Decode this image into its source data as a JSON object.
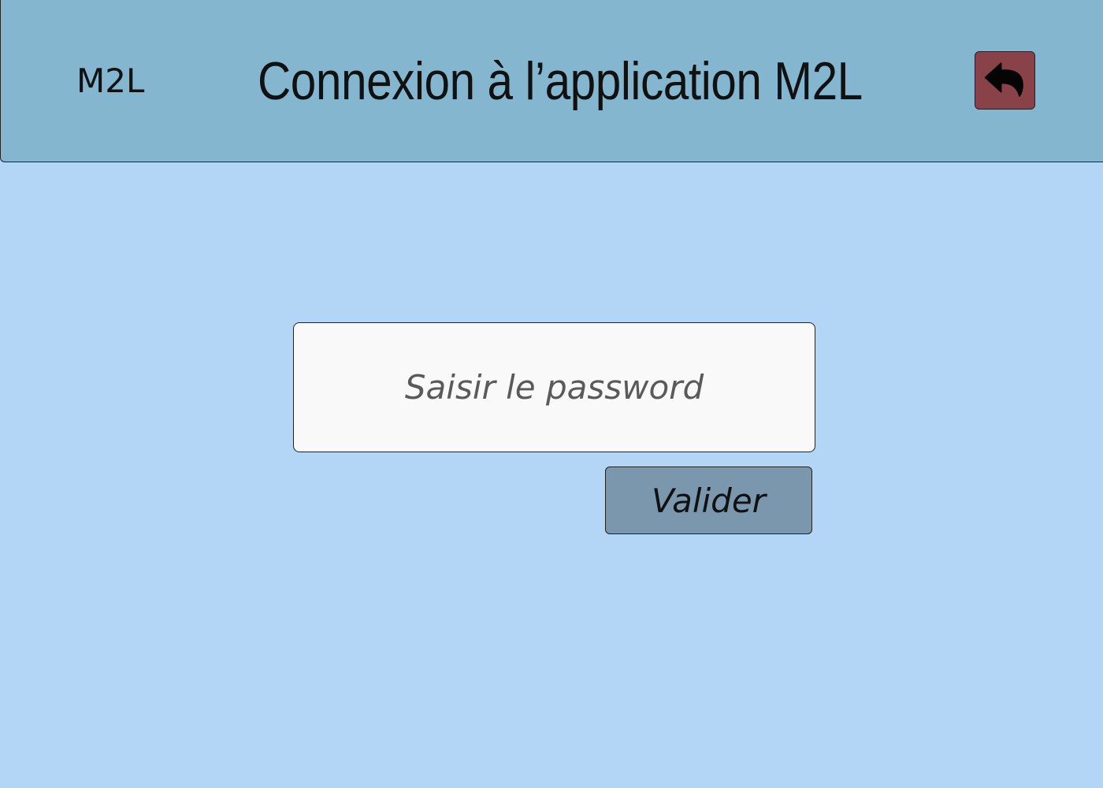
{
  "header": {
    "brand": "M2L",
    "title": "Connexion à l’application M2L",
    "back_icon": "undo-arrow-icon"
  },
  "form": {
    "password_placeholder": "Saisir le password",
    "password_value": "",
    "submit_label": "Valider"
  },
  "colors": {
    "background": "#b3d6f6",
    "header": "#84b7cf",
    "back_button": "#8a4249",
    "submit_button": "#7a97ae",
    "input_background": "#f9f9f9"
  }
}
